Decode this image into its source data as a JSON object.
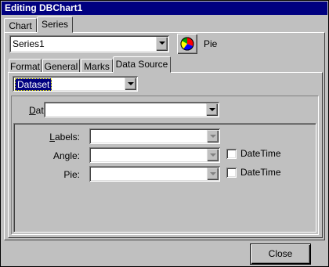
{
  "window": {
    "title": "Editing DBChart1"
  },
  "main_tabs": [
    {
      "label": "Chart"
    },
    {
      "label": "Series"
    }
  ],
  "series": {
    "selected": "Series1",
    "type_label": "Pie"
  },
  "sub_tabs": [
    {
      "label": "Format"
    },
    {
      "label": "General"
    },
    {
      "label": "Marks"
    },
    {
      "label": "Data Source"
    }
  ],
  "data_source": {
    "source_type": "Dataset",
    "dataset_label": "Dataset:",
    "dataset_value": "",
    "fields": [
      {
        "label": "Labels:",
        "value": "",
        "datetime": false
      },
      {
        "label": "Angle:",
        "value": "",
        "datetime": true,
        "datetime_label": "DateTime"
      },
      {
        "label": "Pie:",
        "value": "",
        "datetime": true,
        "datetime_label": "DateTime"
      }
    ]
  },
  "footer": {
    "close_label": "Close"
  },
  "colors": {
    "titlebar": "#000080",
    "selection": "#000080",
    "face": "#c0c0c0"
  }
}
